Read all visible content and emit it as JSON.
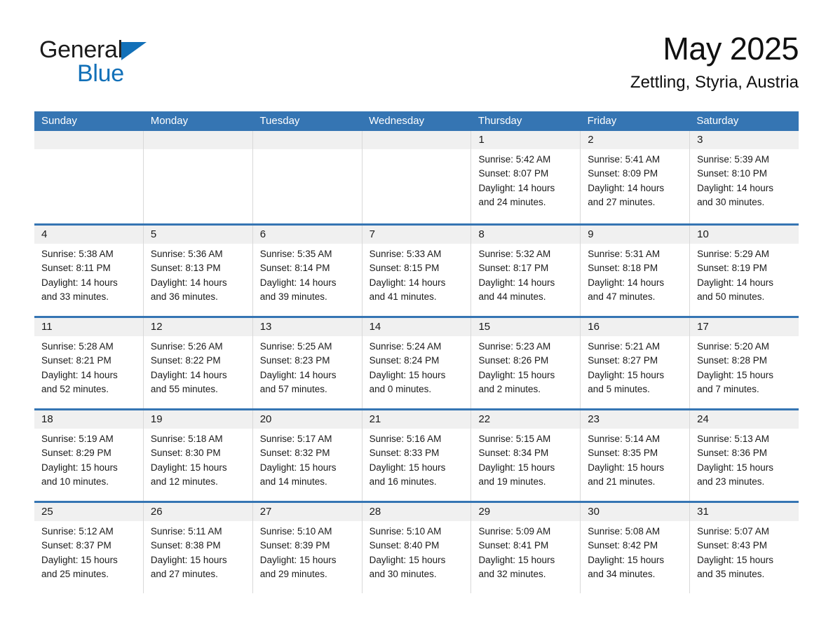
{
  "brand": {
    "name_part1": "General",
    "name_part2": "Blue",
    "triangle_color": "#1270b8"
  },
  "header": {
    "title": "May 2025",
    "location": "Zettling, Styria, Austria"
  },
  "theme": {
    "header_blue": "#3575b3",
    "day_band_gray": "#f0f0f0",
    "cell_border": "#d9d9d9"
  },
  "weekdays": [
    "Sunday",
    "Monday",
    "Tuesday",
    "Wednesday",
    "Thursday",
    "Friday",
    "Saturday"
  ],
  "weeks": [
    [
      {
        "day": "",
        "sunrise": "",
        "sunset": "",
        "daylight1": "",
        "daylight2": ""
      },
      {
        "day": "",
        "sunrise": "",
        "sunset": "",
        "daylight1": "",
        "daylight2": ""
      },
      {
        "day": "",
        "sunrise": "",
        "sunset": "",
        "daylight1": "",
        "daylight2": ""
      },
      {
        "day": "",
        "sunrise": "",
        "sunset": "",
        "daylight1": "",
        "daylight2": ""
      },
      {
        "day": "1",
        "sunrise": "Sunrise: 5:42 AM",
        "sunset": "Sunset: 8:07 PM",
        "daylight1": "Daylight: 14 hours",
        "daylight2": "and 24 minutes."
      },
      {
        "day": "2",
        "sunrise": "Sunrise: 5:41 AM",
        "sunset": "Sunset: 8:09 PM",
        "daylight1": "Daylight: 14 hours",
        "daylight2": "and 27 minutes."
      },
      {
        "day": "3",
        "sunrise": "Sunrise: 5:39 AM",
        "sunset": "Sunset: 8:10 PM",
        "daylight1": "Daylight: 14 hours",
        "daylight2": "and 30 minutes."
      }
    ],
    [
      {
        "day": "4",
        "sunrise": "Sunrise: 5:38 AM",
        "sunset": "Sunset: 8:11 PM",
        "daylight1": "Daylight: 14 hours",
        "daylight2": "and 33 minutes."
      },
      {
        "day": "5",
        "sunrise": "Sunrise: 5:36 AM",
        "sunset": "Sunset: 8:13 PM",
        "daylight1": "Daylight: 14 hours",
        "daylight2": "and 36 minutes."
      },
      {
        "day": "6",
        "sunrise": "Sunrise: 5:35 AM",
        "sunset": "Sunset: 8:14 PM",
        "daylight1": "Daylight: 14 hours",
        "daylight2": "and 39 minutes."
      },
      {
        "day": "7",
        "sunrise": "Sunrise: 5:33 AM",
        "sunset": "Sunset: 8:15 PM",
        "daylight1": "Daylight: 14 hours",
        "daylight2": "and 41 minutes."
      },
      {
        "day": "8",
        "sunrise": "Sunrise: 5:32 AM",
        "sunset": "Sunset: 8:17 PM",
        "daylight1": "Daylight: 14 hours",
        "daylight2": "and 44 minutes."
      },
      {
        "day": "9",
        "sunrise": "Sunrise: 5:31 AM",
        "sunset": "Sunset: 8:18 PM",
        "daylight1": "Daylight: 14 hours",
        "daylight2": "and 47 minutes."
      },
      {
        "day": "10",
        "sunrise": "Sunrise: 5:29 AM",
        "sunset": "Sunset: 8:19 PM",
        "daylight1": "Daylight: 14 hours",
        "daylight2": "and 50 minutes."
      }
    ],
    [
      {
        "day": "11",
        "sunrise": "Sunrise: 5:28 AM",
        "sunset": "Sunset: 8:21 PM",
        "daylight1": "Daylight: 14 hours",
        "daylight2": "and 52 minutes."
      },
      {
        "day": "12",
        "sunrise": "Sunrise: 5:26 AM",
        "sunset": "Sunset: 8:22 PM",
        "daylight1": "Daylight: 14 hours",
        "daylight2": "and 55 minutes."
      },
      {
        "day": "13",
        "sunrise": "Sunrise: 5:25 AM",
        "sunset": "Sunset: 8:23 PM",
        "daylight1": "Daylight: 14 hours",
        "daylight2": "and 57 minutes."
      },
      {
        "day": "14",
        "sunrise": "Sunrise: 5:24 AM",
        "sunset": "Sunset: 8:24 PM",
        "daylight1": "Daylight: 15 hours",
        "daylight2": "and 0 minutes."
      },
      {
        "day": "15",
        "sunrise": "Sunrise: 5:23 AM",
        "sunset": "Sunset: 8:26 PM",
        "daylight1": "Daylight: 15 hours",
        "daylight2": "and 2 minutes."
      },
      {
        "day": "16",
        "sunrise": "Sunrise: 5:21 AM",
        "sunset": "Sunset: 8:27 PM",
        "daylight1": "Daylight: 15 hours",
        "daylight2": "and 5 minutes."
      },
      {
        "day": "17",
        "sunrise": "Sunrise: 5:20 AM",
        "sunset": "Sunset: 8:28 PM",
        "daylight1": "Daylight: 15 hours",
        "daylight2": "and 7 minutes."
      }
    ],
    [
      {
        "day": "18",
        "sunrise": "Sunrise: 5:19 AM",
        "sunset": "Sunset: 8:29 PM",
        "daylight1": "Daylight: 15 hours",
        "daylight2": "and 10 minutes."
      },
      {
        "day": "19",
        "sunrise": "Sunrise: 5:18 AM",
        "sunset": "Sunset: 8:30 PM",
        "daylight1": "Daylight: 15 hours",
        "daylight2": "and 12 minutes."
      },
      {
        "day": "20",
        "sunrise": "Sunrise: 5:17 AM",
        "sunset": "Sunset: 8:32 PM",
        "daylight1": "Daylight: 15 hours",
        "daylight2": "and 14 minutes."
      },
      {
        "day": "21",
        "sunrise": "Sunrise: 5:16 AM",
        "sunset": "Sunset: 8:33 PM",
        "daylight1": "Daylight: 15 hours",
        "daylight2": "and 16 minutes."
      },
      {
        "day": "22",
        "sunrise": "Sunrise: 5:15 AM",
        "sunset": "Sunset: 8:34 PM",
        "daylight1": "Daylight: 15 hours",
        "daylight2": "and 19 minutes."
      },
      {
        "day": "23",
        "sunrise": "Sunrise: 5:14 AM",
        "sunset": "Sunset: 8:35 PM",
        "daylight1": "Daylight: 15 hours",
        "daylight2": "and 21 minutes."
      },
      {
        "day": "24",
        "sunrise": "Sunrise: 5:13 AM",
        "sunset": "Sunset: 8:36 PM",
        "daylight1": "Daylight: 15 hours",
        "daylight2": "and 23 minutes."
      }
    ],
    [
      {
        "day": "25",
        "sunrise": "Sunrise: 5:12 AM",
        "sunset": "Sunset: 8:37 PM",
        "daylight1": "Daylight: 15 hours",
        "daylight2": "and 25 minutes."
      },
      {
        "day": "26",
        "sunrise": "Sunrise: 5:11 AM",
        "sunset": "Sunset: 8:38 PM",
        "daylight1": "Daylight: 15 hours",
        "daylight2": "and 27 minutes."
      },
      {
        "day": "27",
        "sunrise": "Sunrise: 5:10 AM",
        "sunset": "Sunset: 8:39 PM",
        "daylight1": "Daylight: 15 hours",
        "daylight2": "and 29 minutes."
      },
      {
        "day": "28",
        "sunrise": "Sunrise: 5:10 AM",
        "sunset": "Sunset: 8:40 PM",
        "daylight1": "Daylight: 15 hours",
        "daylight2": "and 30 minutes."
      },
      {
        "day": "29",
        "sunrise": "Sunrise: 5:09 AM",
        "sunset": "Sunset: 8:41 PM",
        "daylight1": "Daylight: 15 hours",
        "daylight2": "and 32 minutes."
      },
      {
        "day": "30",
        "sunrise": "Sunrise: 5:08 AM",
        "sunset": "Sunset: 8:42 PM",
        "daylight1": "Daylight: 15 hours",
        "daylight2": "and 34 minutes."
      },
      {
        "day": "31",
        "sunrise": "Sunrise: 5:07 AM",
        "sunset": "Sunset: 8:43 PM",
        "daylight1": "Daylight: 15 hours",
        "daylight2": "and 35 minutes."
      }
    ]
  ]
}
